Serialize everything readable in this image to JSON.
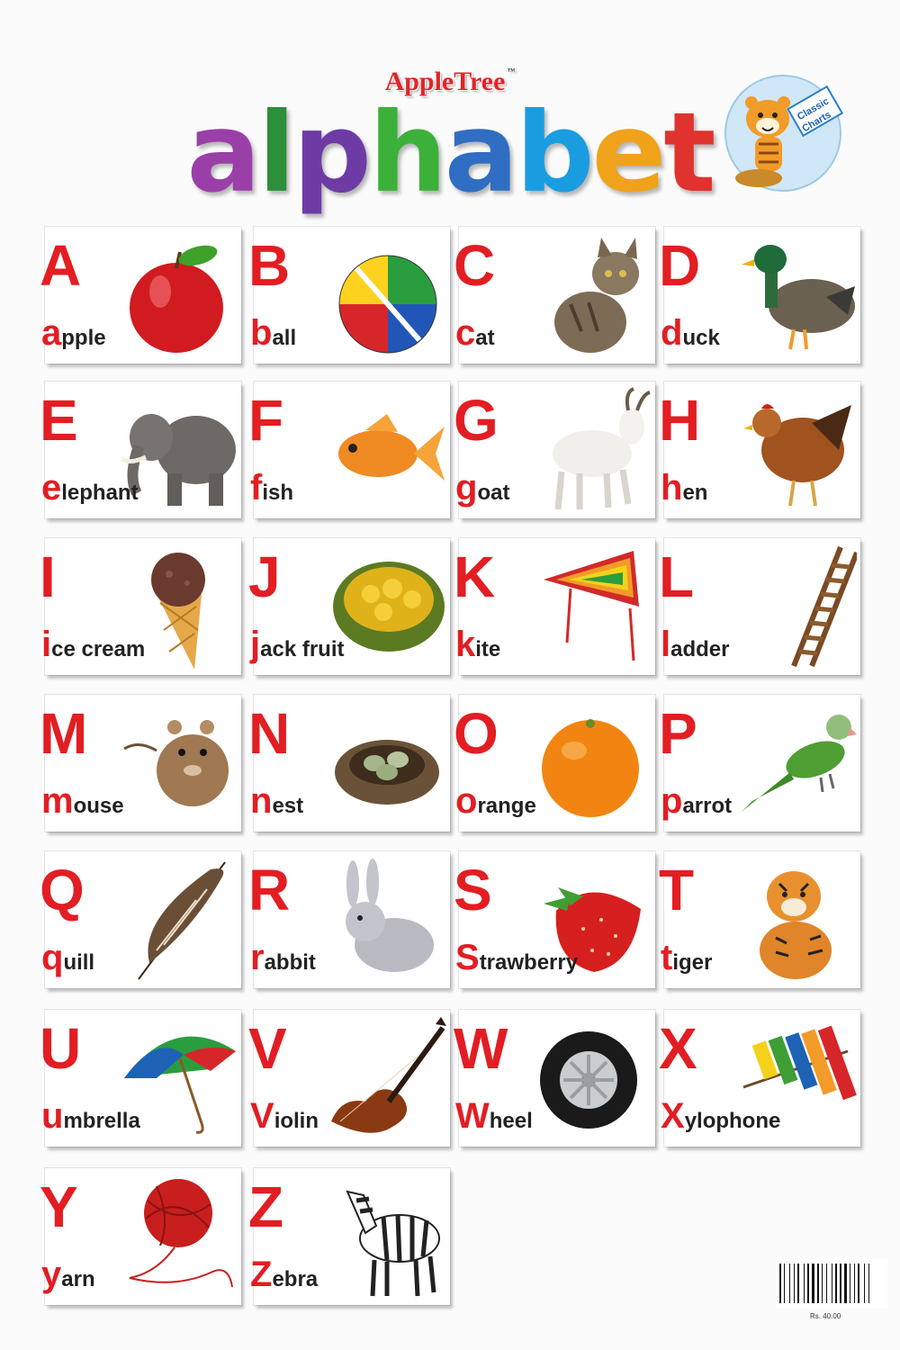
{
  "brand": {
    "name": "AppleTree",
    "tm": "™"
  },
  "title": {
    "letters": [
      {
        "ch": "a",
        "color": "#9b3fa8"
      },
      {
        "ch": "l",
        "color": "#2c8f3a"
      },
      {
        "ch": "p",
        "color": "#6e3ba5"
      },
      {
        "ch": "h",
        "color": "#3cb13a"
      },
      {
        "ch": "a",
        "color": "#2f6ec2"
      },
      {
        "ch": "b",
        "color": "#1a9de0"
      },
      {
        "ch": "e",
        "color": "#f0a21a"
      },
      {
        "ch": "t",
        "color": "#e0332d"
      }
    ]
  },
  "badge": {
    "line1": "Classic",
    "line2": "Charts"
  },
  "cards": [
    {
      "cap": "A",
      "first": "a",
      "rest": "pple",
      "icon": "apple-icon"
    },
    {
      "cap": "B",
      "first": "b",
      "rest": "all",
      "icon": "ball-icon"
    },
    {
      "cap": "C",
      "first": "c",
      "rest": "at",
      "icon": "cat-icon"
    },
    {
      "cap": "D",
      "first": "d",
      "rest": "uck",
      "icon": "duck-icon"
    },
    {
      "cap": "E",
      "first": "e",
      "rest": "lephant",
      "icon": "elephant-icon"
    },
    {
      "cap": "F",
      "first": "f",
      "rest": "ish",
      "icon": "fish-icon"
    },
    {
      "cap": "G",
      "first": "g",
      "rest": "oat",
      "icon": "goat-icon"
    },
    {
      "cap": "H",
      "first": "h",
      "rest": "en",
      "icon": "hen-icon"
    },
    {
      "cap": "I",
      "first": "i",
      "rest": "ce cream",
      "icon": "ice-cream-icon"
    },
    {
      "cap": "J",
      "first": "j",
      "rest": "ack fruit",
      "icon": "jackfruit-icon"
    },
    {
      "cap": "K",
      "first": "k",
      "rest": "ite",
      "icon": "kite-icon"
    },
    {
      "cap": "L",
      "first": "l",
      "rest": "adder",
      "icon": "ladder-icon"
    },
    {
      "cap": "M",
      "first": "m",
      "rest": "ouse",
      "icon": "mouse-icon"
    },
    {
      "cap": "N",
      "first": "n",
      "rest": "est",
      "icon": "nest-icon"
    },
    {
      "cap": "O",
      "first": "o",
      "rest": "range",
      "icon": "orange-icon"
    },
    {
      "cap": "P",
      "first": "p",
      "rest": "arrot",
      "icon": "parrot-icon"
    },
    {
      "cap": "Q",
      "first": "q",
      "rest": "uill",
      "icon": "quill-icon"
    },
    {
      "cap": "R",
      "first": "r",
      "rest": "abbit",
      "icon": "rabbit-icon"
    },
    {
      "cap": "S",
      "first": "S",
      "rest": "trawberry",
      "icon": "strawberry-icon"
    },
    {
      "cap": "T",
      "first": "t",
      "rest": "iger",
      "icon": "tiger-icon"
    },
    {
      "cap": "U",
      "first": "u",
      "rest": "mbrella",
      "icon": "umbrella-icon"
    },
    {
      "cap": "V",
      "first": "V",
      "rest": "iolin",
      "icon": "violin-icon"
    },
    {
      "cap": "W",
      "first": "W",
      "rest": "heel",
      "icon": "wheel-icon"
    },
    {
      "cap": "X",
      "first": "X",
      "rest": "ylophone",
      "icon": "xylophone-icon"
    },
    {
      "cap": "Y",
      "first": "y",
      "rest": "arn",
      "icon": "yarn-icon"
    },
    {
      "cap": "Z",
      "first": "Z",
      "rest": "ebra",
      "icon": "zebra-icon"
    }
  ],
  "footer": {
    "price": "Rs. 40.00"
  }
}
